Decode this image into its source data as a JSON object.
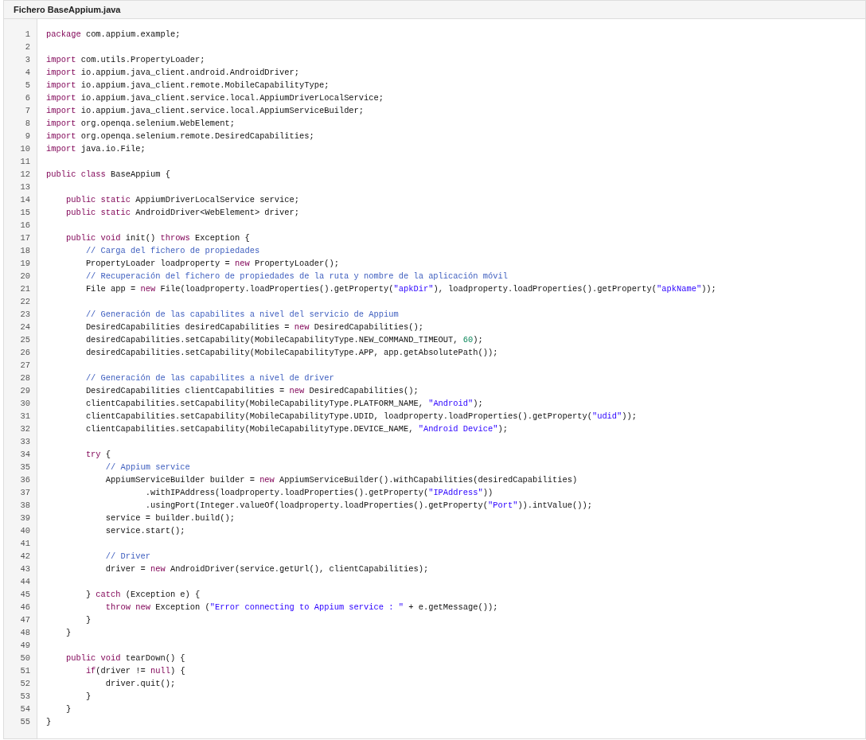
{
  "file_title": "Fichero BaseAppium.java",
  "lines": [
    {
      "number": "1",
      "code": [
        {
          "kind": "keyword",
          "text": "package"
        },
        {
          "kind": "plain",
          "text": " com.appium.example;"
        }
      ]
    },
    {
      "number": "2"
    },
    {
      "number": "3",
      "code": [
        {
          "kind": "keyword",
          "text": "import"
        },
        {
          "kind": "plain",
          "text": " com.utils.PropertyLoader;"
        }
      ]
    },
    {
      "number": "4",
      "code": [
        {
          "kind": "keyword",
          "text": "import"
        },
        {
          "kind": "plain",
          "text": " io.appium.java_client.android.AndroidDriver;"
        }
      ]
    },
    {
      "number": "5",
      "code": [
        {
          "kind": "keyword",
          "text": "import"
        },
        {
          "kind": "plain",
          "text": " io.appium.java_client.remote.MobileCapabilityType;"
        }
      ]
    },
    {
      "number": "6",
      "code": [
        {
          "kind": "keyword",
          "text": "import"
        },
        {
          "kind": "plain",
          "text": " io.appium.java_client.service.local.AppiumDriverLocalService;"
        }
      ]
    },
    {
      "number": "7",
      "code": [
        {
          "kind": "keyword",
          "text": "import"
        },
        {
          "kind": "plain",
          "text": " io.appium.java_client.service.local.AppiumServiceBuilder;"
        }
      ]
    },
    {
      "number": "8",
      "code": [
        {
          "kind": "keyword",
          "text": "import"
        },
        {
          "kind": "plain",
          "text": " org.openqa.selenium.WebElement;"
        }
      ]
    },
    {
      "number": "9",
      "code": [
        {
          "kind": "keyword",
          "text": "import"
        },
        {
          "kind": "plain",
          "text": " org.openqa.selenium.remote.DesiredCapabilities;"
        }
      ]
    },
    {
      "number": "10",
      "code": [
        {
          "kind": "keyword",
          "text": "import"
        },
        {
          "kind": "plain",
          "text": " java.io.File;"
        }
      ]
    },
    {
      "number": "11"
    },
    {
      "number": "12",
      "code": [
        {
          "kind": "keyword",
          "text": "public class"
        },
        {
          "kind": "plain",
          "text": " BaseAppium {"
        }
      ]
    },
    {
      "number": "13"
    },
    {
      "number": "14",
      "code": [
        {
          "kind": "keyword",
          "text": "    public static"
        },
        {
          "kind": "plain",
          "text": " AppiumDriverLocalService service;"
        }
      ]
    },
    {
      "number": "15",
      "code": [
        {
          "kind": "keyword",
          "text": "    public static"
        },
        {
          "kind": "plain",
          "text": " AndroidDriver<WebElement> driver;"
        }
      ]
    },
    {
      "number": "16"
    },
    {
      "number": "17",
      "code": [
        {
          "kind": "keyword",
          "text": "    public void"
        },
        {
          "kind": "plain",
          "text": " init() "
        },
        {
          "kind": "keyword",
          "text": "throws"
        },
        {
          "kind": "plain",
          "text": " Exception {"
        }
      ]
    },
    {
      "number": "18",
      "code": [
        {
          "kind": "comment",
          "text": "        // Carga del fichero de propiedades"
        }
      ]
    },
    {
      "number": "19",
      "code": [
        {
          "kind": "plain",
          "text": "        PropertyLoader loadproperty = "
        },
        {
          "kind": "keyword",
          "text": "new"
        },
        {
          "kind": "plain",
          "text": " PropertyLoader();"
        }
      ]
    },
    {
      "number": "20",
      "code": [
        {
          "kind": "comment",
          "text": "        // Recuperación del fichero de propiedades de la ruta y nombre de la aplicación móvil"
        }
      ]
    },
    {
      "number": "21",
      "code": [
        {
          "kind": "plain",
          "text": "        File app = "
        },
        {
          "kind": "keyword",
          "text": "new"
        },
        {
          "kind": "plain",
          "text": " File(loadproperty.loadProperties().getProperty("
        },
        {
          "kind": "string",
          "text": "\"apkDir\""
        },
        {
          "kind": "plain",
          "text": "), loadproperty.loadProperties().getProperty("
        },
        {
          "kind": "string",
          "text": "\"apkName\""
        },
        {
          "kind": "plain",
          "text": "));"
        }
      ]
    },
    {
      "number": "22"
    },
    {
      "number": "23",
      "code": [
        {
          "kind": "comment",
          "text": "        // Generación de las capabilites a nivel del servicio de Appium"
        }
      ]
    },
    {
      "number": "24",
      "code": [
        {
          "kind": "plain",
          "text": "        DesiredCapabilities desiredCapabilities = "
        },
        {
          "kind": "keyword",
          "text": "new"
        },
        {
          "kind": "plain",
          "text": " DesiredCapabilities();"
        }
      ]
    },
    {
      "number": "25",
      "code": [
        {
          "kind": "plain",
          "text": "        desiredCapabilities.setCapability(MobileCapabilityType.NEW_COMMAND_TIMEOUT, "
        },
        {
          "kind": "number",
          "text": "60"
        },
        {
          "kind": "plain",
          "text": ");"
        }
      ]
    },
    {
      "number": "26",
      "code": [
        {
          "kind": "plain",
          "text": "        desiredCapabilities.setCapability(MobileCapabilityType.APP, app.getAbsolutePath());"
        }
      ]
    },
    {
      "number": "27"
    },
    {
      "number": "28",
      "code": [
        {
          "kind": "comment",
          "text": "        // Generación de las capabilites a nivel de driver"
        }
      ]
    },
    {
      "number": "29",
      "code": [
        {
          "kind": "plain",
          "text": "        DesiredCapabilities clientCapabilities = "
        },
        {
          "kind": "keyword",
          "text": "new"
        },
        {
          "kind": "plain",
          "text": " DesiredCapabilities();"
        }
      ]
    },
    {
      "number": "30",
      "code": [
        {
          "kind": "plain",
          "text": "        clientCapabilities.setCapability(MobileCapabilityType.PLATFORM_NAME, "
        },
        {
          "kind": "string",
          "text": "\"Android\""
        },
        {
          "kind": "plain",
          "text": ");"
        }
      ]
    },
    {
      "number": "31",
      "code": [
        {
          "kind": "plain",
          "text": "        clientCapabilities.setCapability(MobileCapabilityType.UDID, loadproperty.loadProperties().getProperty("
        },
        {
          "kind": "string",
          "text": "\"udid\""
        },
        {
          "kind": "plain",
          "text": "));"
        }
      ]
    },
    {
      "number": "32",
      "code": [
        {
          "kind": "plain",
          "text": "        clientCapabilities.setCapability(MobileCapabilityType.DEVICE_NAME, "
        },
        {
          "kind": "string",
          "text": "\"Android Device\""
        },
        {
          "kind": "plain",
          "text": ");"
        }
      ]
    },
    {
      "number": "33"
    },
    {
      "number": "34",
      "code": [
        {
          "kind": "keyword",
          "text": "        try"
        },
        {
          "kind": "plain",
          "text": " {"
        }
      ]
    },
    {
      "number": "35",
      "code": [
        {
          "kind": "comment",
          "text": "            // Appium service"
        }
      ]
    },
    {
      "number": "36",
      "code": [
        {
          "kind": "plain",
          "text": "            AppiumServiceBuilder builder = "
        },
        {
          "kind": "keyword",
          "text": "new"
        },
        {
          "kind": "plain",
          "text": " AppiumServiceBuilder().withCapabilities(desiredCapabilities)"
        }
      ]
    },
    {
      "number": "37",
      "code": [
        {
          "kind": "plain",
          "text": "                    .withIPAddress(loadproperty.loadProperties().getProperty("
        },
        {
          "kind": "string",
          "text": "\"IPAddress\""
        },
        {
          "kind": "plain",
          "text": "))"
        }
      ]
    },
    {
      "number": "38",
      "code": [
        {
          "kind": "plain",
          "text": "                    .usingPort(Integer.valueOf(loadproperty.loadProperties().getProperty("
        },
        {
          "kind": "string",
          "text": "\"Port\""
        },
        {
          "kind": "plain",
          "text": ")).intValue());"
        }
      ]
    },
    {
      "number": "39",
      "code": [
        {
          "kind": "plain",
          "text": "            service = builder.build();"
        }
      ]
    },
    {
      "number": "40",
      "code": [
        {
          "kind": "plain",
          "text": "            service.start();"
        }
      ]
    },
    {
      "number": "41"
    },
    {
      "number": "42",
      "code": [
        {
          "kind": "comment",
          "text": "            // Driver"
        }
      ]
    },
    {
      "number": "43",
      "code": [
        {
          "kind": "plain",
          "text": "            driver = "
        },
        {
          "kind": "keyword",
          "text": "new"
        },
        {
          "kind": "plain",
          "text": " AndroidDriver(service.getUrl(), clientCapabilities);"
        }
      ]
    },
    {
      "number": "44"
    },
    {
      "number": "45",
      "code": [
        {
          "kind": "plain",
          "text": "        } "
        },
        {
          "kind": "keyword",
          "text": "catch"
        },
        {
          "kind": "plain",
          "text": " (Exception e) {"
        }
      ]
    },
    {
      "number": "46",
      "code": [
        {
          "kind": "keyword",
          "text": "            throw new"
        },
        {
          "kind": "plain",
          "text": " Exception ("
        },
        {
          "kind": "string",
          "text": "\"Error connecting to Appium service : \""
        },
        {
          "kind": "plain",
          "text": " + e.getMessage());"
        }
      ]
    },
    {
      "number": "47",
      "code": [
        {
          "kind": "plain",
          "text": "        }"
        }
      ]
    },
    {
      "number": "48",
      "code": [
        {
          "kind": "plain",
          "text": "    }"
        }
      ]
    },
    {
      "number": "49"
    },
    {
      "number": "50",
      "code": [
        {
          "kind": "keyword",
          "text": "    public void"
        },
        {
          "kind": "plain",
          "text": " tearDown() {"
        }
      ]
    },
    {
      "number": "51",
      "code": [
        {
          "kind": "keyword",
          "text": "        if"
        },
        {
          "kind": "plain",
          "text": "(driver != "
        },
        {
          "kind": "keyword",
          "text": "null"
        },
        {
          "kind": "plain",
          "text": ") {"
        }
      ]
    },
    {
      "number": "52",
      "code": [
        {
          "kind": "plain",
          "text": "            driver.quit();"
        }
      ]
    },
    {
      "number": "53",
      "code": [
        {
          "kind": "plain",
          "text": "        }"
        }
      ]
    },
    {
      "number": "54",
      "code": [
        {
          "kind": "plain",
          "text": "    }"
        }
      ]
    },
    {
      "number": "55",
      "code": [
        {
          "kind": "plain",
          "text": "}"
        }
      ]
    }
  ]
}
